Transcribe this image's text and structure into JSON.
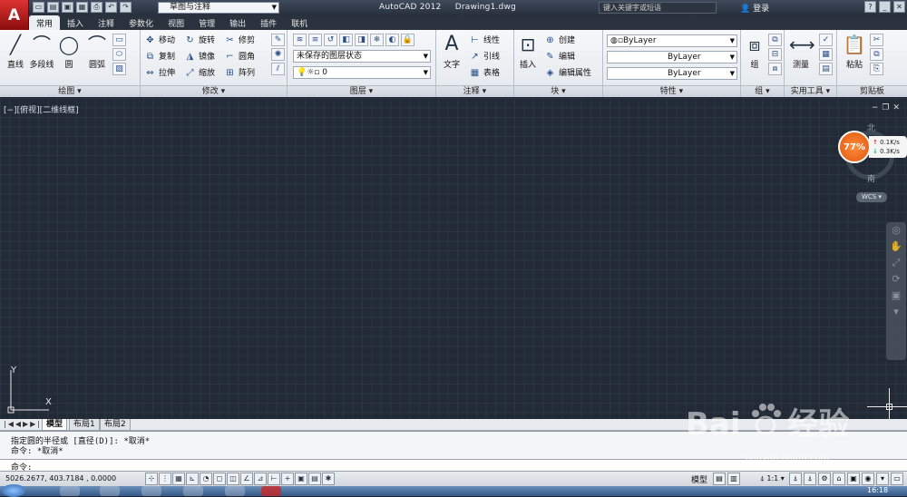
{
  "titlebar": {
    "app_title": "AutoCAD 2012",
    "doc_title": "Drawing1.dwg",
    "workspace": "草图与注释",
    "search_placeholder": "键入关键字或短语",
    "login": "登录"
  },
  "tabs": [
    "常用",
    "插入",
    "注释",
    "参数化",
    "视图",
    "管理",
    "输出",
    "插件",
    "联机"
  ],
  "active_tab": "常用",
  "ribbon": {
    "draw": {
      "title": "绘图",
      "line": "直线",
      "polyline": "多段线",
      "circle": "圆",
      "arc": "圆弧"
    },
    "modify": {
      "title": "修改",
      "move": "移动",
      "rotate": "旋转",
      "trim": "修剪",
      "copy": "复制",
      "mirror": "镜像",
      "fillet": "圆角",
      "stretch": "拉伸",
      "scale": "缩放",
      "array": "阵列"
    },
    "layers": {
      "title": "图层",
      "state": "未保存的图层状态",
      "layer": "0"
    },
    "annotation": {
      "title": "注释",
      "text": "文字",
      "linear": "线性",
      "leader": "引线",
      "table": "表格"
    },
    "block": {
      "title": "块",
      "insert": "插入",
      "create": "创建",
      "edit": "编辑",
      "edit_attr": "编辑属性"
    },
    "properties": {
      "title": "特性",
      "color": "ByLayer",
      "linetype": "ByLayer",
      "lineweight": "ByLayer"
    },
    "groups": {
      "title": "组",
      "group": "组"
    },
    "utilities": {
      "title": "实用工具",
      "measure": "测量"
    },
    "clipboard": {
      "title": "剪贴板",
      "paste": "粘贴"
    }
  },
  "viewport": {
    "label": "[−][俯视][二维线框]",
    "compass_north": "北",
    "compass_south": "南",
    "wcs": "WCS",
    "meter_percent": "77%",
    "net_up": "0.1K/s",
    "net_down": "0.3K/s",
    "ucs_y": "Y",
    "ucs_x": "X"
  },
  "layout_tabs": [
    "模型",
    "布局1",
    "布局2"
  ],
  "active_layout": "模型",
  "command": {
    "history": [
      "指定圆的半径或 [直径(D)]: *取消*",
      "命令: *取消*"
    ],
    "prompt": "命令:"
  },
  "status": {
    "coords": "5026.2677, 403.7184 , 0.0000",
    "model": "模型",
    "scale": "1:1"
  },
  "taskbar": {
    "clock": "16:18"
  },
  "watermark": {
    "brand": "Bai",
    "brand2": "经验",
    "url": "jingyan.baidu.com"
  }
}
